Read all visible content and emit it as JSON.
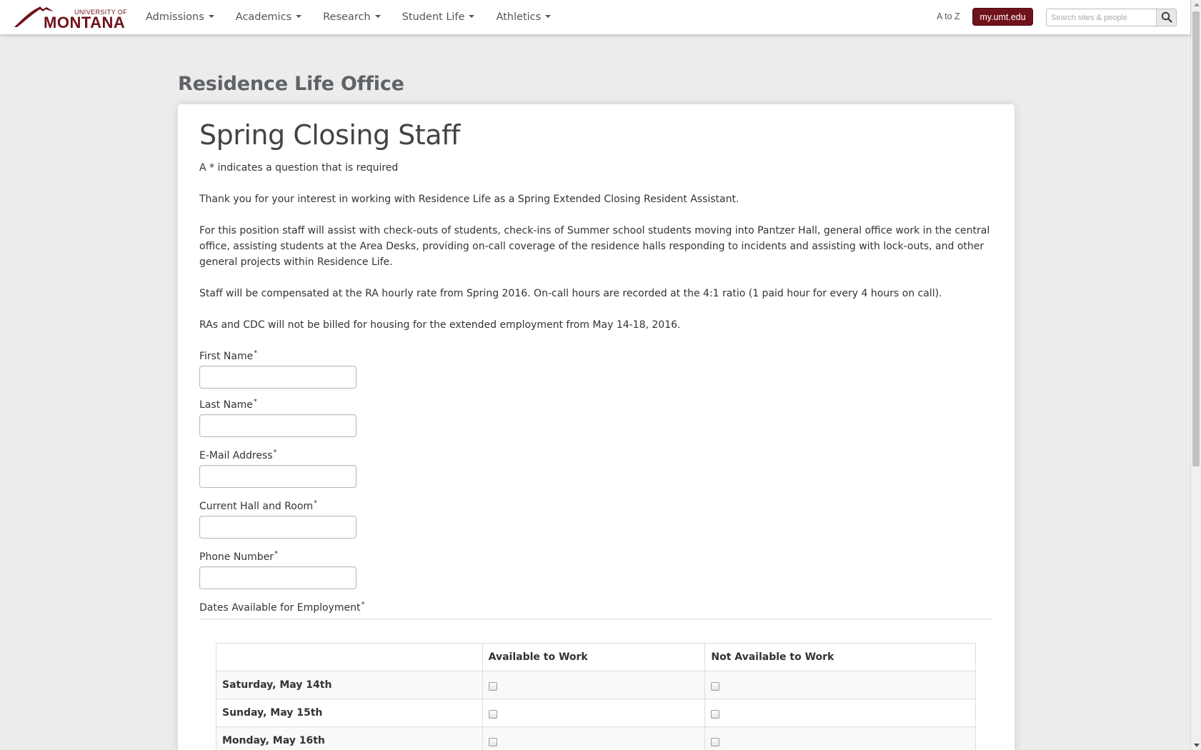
{
  "navbar": {
    "logo_top": "UNIVERSITY OF",
    "logo_main": "MONTANA",
    "menu": [
      {
        "label": "Admissions"
      },
      {
        "label": "Academics"
      },
      {
        "label": "Research"
      },
      {
        "label": "Student Life"
      },
      {
        "label": "Athletics"
      }
    ],
    "a_to_z": "A to Z",
    "portal_label": "my.umt.edu",
    "search_placeholder": "Search sites & people",
    "brand_color": "#70121a"
  },
  "page": {
    "site_title": "Residence Life Office",
    "form_title": "Spring Closing Staff",
    "required_note": "A * indicates a question that is required",
    "paragraphs": [
      "Thank you for  your interest in working with Residence Life as a Spring Extended Closing Resident Assistant.",
      "For this position staff will assist with check-outs of students, check-ins of Summer school students moving into Pantzer Hall, general office work in the central office, assisting students at the Area Desks, providing on-call coverage of the residence halls responding to incidents and assisting with lock-outs, and other general projects within Residence Life.",
      "Staff will be compensated at the RA hourly rate from Spring 2016. On-call hours are recorded at the 4:1 ratio (1 paid hour for every 4 hours on call).",
      "RAs and CDC will not be billed for housing for the extended employment from May 14-18, 2016."
    ],
    "fields": [
      {
        "label": "First Name",
        "required_mark": "*",
        "value": ""
      },
      {
        "label": "Last Name",
        "required_mark": "*",
        "value": ""
      },
      {
        "label": "E-Mail Address",
        "required_mark": "*",
        "value": ""
      },
      {
        "label": "Current Hall and Room",
        "required_mark": "*",
        "value": ""
      },
      {
        "label": "Phone Number",
        "required_mark": "*",
        "value": ""
      }
    ],
    "availability": {
      "label": "Dates Available for Employment",
      "required_mark": "*",
      "columns": [
        "",
        "Available to Work",
        "Not Available to Work"
      ],
      "rows": [
        {
          "day": "Saturday, May 14th",
          "available": false,
          "not_available": false
        },
        {
          "day": "Sunday, May 15th",
          "available": false,
          "not_available": false
        },
        {
          "day": "Monday, May 16th",
          "available": false,
          "not_available": false
        }
      ]
    }
  }
}
